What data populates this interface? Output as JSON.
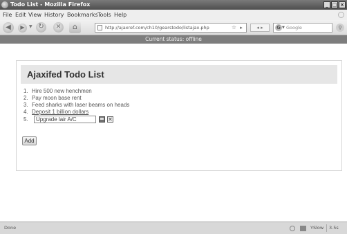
{
  "window": {
    "title": "Todo List - Mozilla Firefox",
    "buttons": [
      "_",
      "□",
      "×"
    ]
  },
  "menu": {
    "items": [
      {
        "label": "File"
      },
      {
        "label": "Edit"
      },
      {
        "label": "View"
      },
      {
        "label": "History"
      },
      {
        "label": "Bookmarks"
      },
      {
        "label": "Tools"
      },
      {
        "label": "Help"
      }
    ]
  },
  "toolbar": {
    "url": "http://ajaxref.com/ch10/gearstodo/listajax.php",
    "search_placeholder": "Google",
    "back_glyph": "◀",
    "forward_glyph": "▶",
    "reload_glyph": "↻",
    "stop_glyph": "✕",
    "home_glyph": "⌂",
    "go_glyph": "▸",
    "star_glyph": "☆",
    "history_glyph": "◂ ▸",
    "google_glyph": "G",
    "search_glyph": "⚲"
  },
  "banner": {
    "status_text": "Current status: offline"
  },
  "app": {
    "heading": "Ajaxifed Todo List",
    "todos": [
      {
        "num": "1.",
        "text": "Hire 500 new henchmen",
        "link": false
      },
      {
        "num": "2.",
        "text": "Pay moon base rent",
        "link": false
      },
      {
        "num": "3.",
        "text": "Feed sharks with laser beams on heads",
        "link": false
      },
      {
        "num": "4.",
        "text": "Deposit 1 billion dollars",
        "link": true
      }
    ],
    "editing": {
      "num": "5.",
      "value": "Upgrade lair A/C"
    },
    "cancel_glyph": "✕",
    "add_label": "Add"
  },
  "statusbar": {
    "left": "Done",
    "yslow": "YSlow",
    "time": "3.5s"
  },
  "colors": {
    "banner": "#7d7d7d",
    "heading_bar": "#e6e6e6",
    "titlebar": "#4e4e4e"
  }
}
